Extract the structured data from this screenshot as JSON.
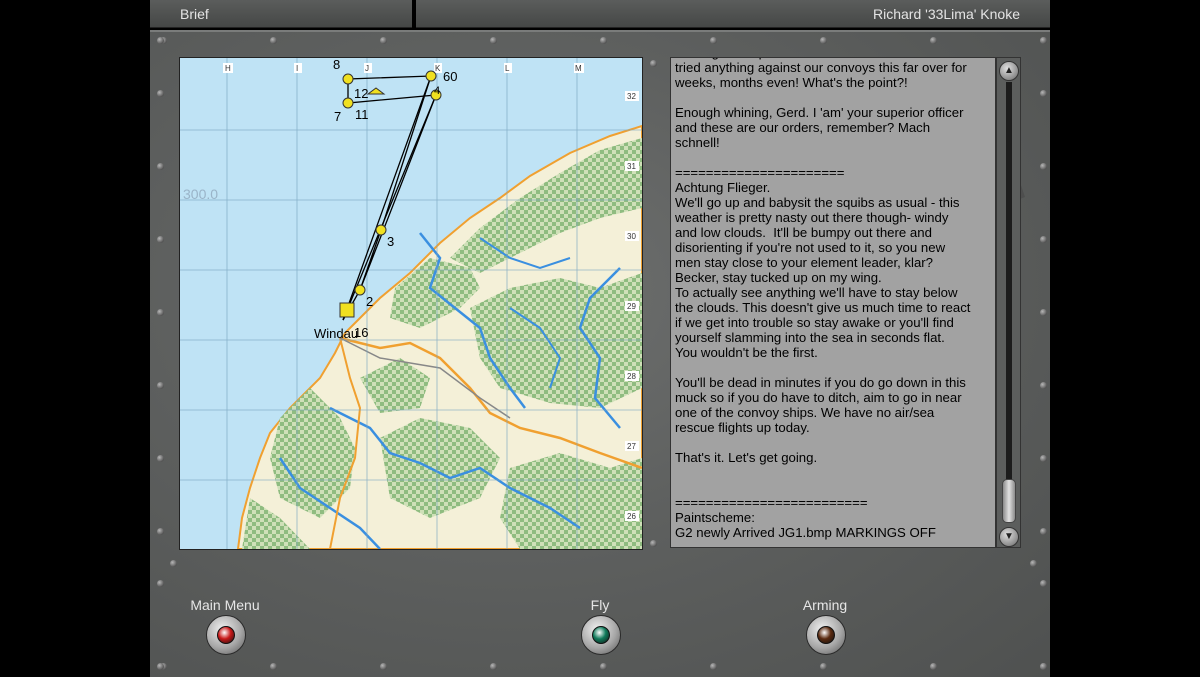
{
  "window": {
    "left_title": "Brief",
    "right_title": "Richard '33Lima' Knoke"
  },
  "map": {
    "column_labels": [
      "H",
      "I",
      "J",
      "K",
      "L",
      "M"
    ],
    "row_labels": [
      "32",
      "31",
      "30",
      "29",
      "28",
      "27",
      "26"
    ],
    "altitude_label": "300.0",
    "town_label": "Windau",
    "waypoints": [
      "2",
      "3",
      "4",
      "7",
      "8",
      "11",
      "12",
      "16",
      "60"
    ],
    "colors": {
      "sea": "#bfe3f5",
      "land": "#f4f0d8",
      "forest": "#9cc490",
      "river": "#3a8fe0",
      "road": "#f0a030",
      "route": "#000000",
      "waypoint": "#f0e020"
    }
  },
  "briefing": {
    "text": "running these patrols? The Britishers haven't\ntried anything against our convoys this far over for\nweeks, months even! What's the point?!\n\nEnough whining, Gerd. I 'am' your superior officer\nand these are our orders, remember? Mach\nschnell!\n\n======================\nAchtung Flieger.\nWe'll go up and babysit the squibs as usual - this\nweather is pretty nasty out there though- windy\nand low clouds.  It'll be bumpy out there and\ndisorienting if you're not used to it, so you new\nmen stay close to your element leader, klar?\nBecker, stay tucked up on my wing.\nTo actually see anything we'll have to stay below\nthe clouds. This doesn't give us much time to react\nif we get into trouble so stay awake or you'll find\nyourself slamming into the sea in seconds flat.\nYou wouldn't be the first.\n\nYou'll be dead in minutes if you do go down in this\nmuck so if you do have to ditch, aim to go in near\none of the convoy ships. We have no air/sea\nrescue flights up today.\n\nThat's it. Let's get going.\n\n\n=========================\nPaintscheme:\nG2 newly Arrived JG1.bmp MARKINGS OFF"
  },
  "buttons": {
    "main_menu": "Main Menu",
    "fly": "Fly",
    "arming": "Arming"
  },
  "lamp_colors": {
    "main_menu": "#c81818",
    "fly": "#0f7a5a",
    "arming": "#5a2a10"
  }
}
